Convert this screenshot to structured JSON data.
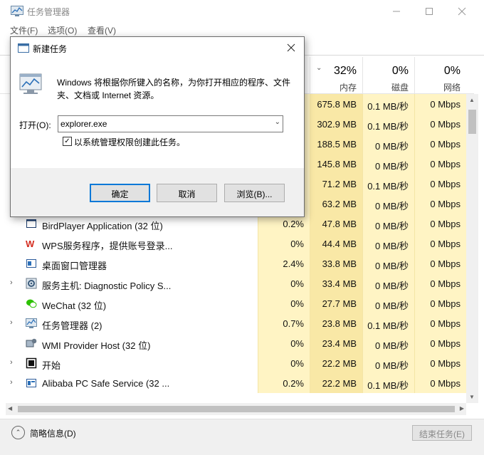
{
  "window": {
    "title": "任务管理器"
  },
  "menu": {
    "file": "文件(F)",
    "options": "选项(O)",
    "view": "查看(V)"
  },
  "columns": {
    "cpu": {
      "pct": "",
      "label": ""
    },
    "memory": {
      "pct": "32%",
      "label": "内存"
    },
    "disk": {
      "pct": "0%",
      "label": "磁盘"
    },
    "network": {
      "pct": "0%",
      "label": "网络"
    }
  },
  "rows": [
    {
      "name": "",
      "expandable": false,
      "icon": "hidden-icon",
      "cpu": "",
      "memory": "675.8 MB",
      "disk": "0.1 MB/秒",
      "network": "0 Mbps"
    },
    {
      "name": "",
      "expandable": false,
      "icon": "hidden-icon",
      "cpu": "",
      "memory": "302.9 MB",
      "disk": "0.1 MB/秒",
      "network": "0 Mbps"
    },
    {
      "name": "",
      "expandable": false,
      "icon": "hidden-icon",
      "cpu": "",
      "memory": "188.5 MB",
      "disk": "0 MB/秒",
      "network": "0 Mbps"
    },
    {
      "name": "",
      "expandable": false,
      "icon": "hidden-icon",
      "cpu": "",
      "memory": "145.8 MB",
      "disk": "0 MB/秒",
      "network": "0 Mbps"
    },
    {
      "name": "",
      "expandable": false,
      "icon": "hidden-icon",
      "cpu": "",
      "memory": "71.2 MB",
      "disk": "0.1 MB/秒",
      "network": "0 Mbps"
    },
    {
      "name": "",
      "expandable": false,
      "icon": "hidden-icon",
      "cpu": "",
      "memory": "63.2 MB",
      "disk": "0 MB/秒",
      "network": "0 Mbps"
    },
    {
      "name": "BirdPlayer Application (32 位)",
      "expandable": false,
      "icon": "window-icon",
      "cpu": "0.2%",
      "memory": "47.8 MB",
      "disk": "0 MB/秒",
      "network": "0 Mbps"
    },
    {
      "name": "WPS服务程序，提供账号登录...",
      "expandable": false,
      "icon": "wps-icon",
      "cpu": "0%",
      "memory": "44.4 MB",
      "disk": "0 MB/秒",
      "network": "0 Mbps"
    },
    {
      "name": "桌面窗口管理器",
      "expandable": false,
      "icon": "desktop-window-icon",
      "cpu": "2.4%",
      "memory": "33.8 MB",
      "disk": "0 MB/秒",
      "network": "0 Mbps"
    },
    {
      "name": "服务主机: Diagnostic Policy S...",
      "expandable": true,
      "icon": "gear-icon",
      "cpu": "0%",
      "memory": "33.4 MB",
      "disk": "0 MB/秒",
      "network": "0 Mbps"
    },
    {
      "name": "WeChat (32 位)",
      "expandable": false,
      "icon": "wechat-icon",
      "cpu": "0%",
      "memory": "27.7 MB",
      "disk": "0 MB/秒",
      "network": "0 Mbps"
    },
    {
      "name": "任务管理器 (2)",
      "expandable": true,
      "icon": "task-manager-icon",
      "cpu": "0.7%",
      "memory": "23.8 MB",
      "disk": "0.1 MB/秒",
      "network": "0 Mbps"
    },
    {
      "name": "WMI Provider Host (32 位)",
      "expandable": false,
      "icon": "wmi-icon",
      "cpu": "0%",
      "memory": "23.4 MB",
      "disk": "0 MB/秒",
      "network": "0 Mbps"
    },
    {
      "name": "开始",
      "expandable": true,
      "icon": "start-icon",
      "cpu": "0%",
      "memory": "22.2 MB",
      "disk": "0 MB/秒",
      "network": "0 Mbps"
    },
    {
      "name": "Alibaba PC Safe Service (32 ...",
      "expandable": true,
      "icon": "alibaba-icon",
      "cpu": "0.2%",
      "memory": "22.2 MB",
      "disk": "0.1 MB/秒",
      "network": "0 Mbps"
    }
  ],
  "footer": {
    "brief": "简略信息(D)",
    "end_task": "结束任务(E)"
  },
  "dialog": {
    "title": "新建任务",
    "description": "Windows 将根据你所键入的名称，为你打开相应的程序、文件夹、文档或 Internet 资源。",
    "open_label": "打开(O):",
    "open_value": "explorer.exe",
    "admin_checked": true,
    "admin_label": "以系统管理权限创建此任务。",
    "ok": "确定",
    "cancel": "取消",
    "browse": "浏览(B)..."
  },
  "colors": {
    "cell_yellow": "#fff4c4",
    "cell_memory_orange": "#f9e8a6",
    "accent_blue": "#0078d7"
  }
}
